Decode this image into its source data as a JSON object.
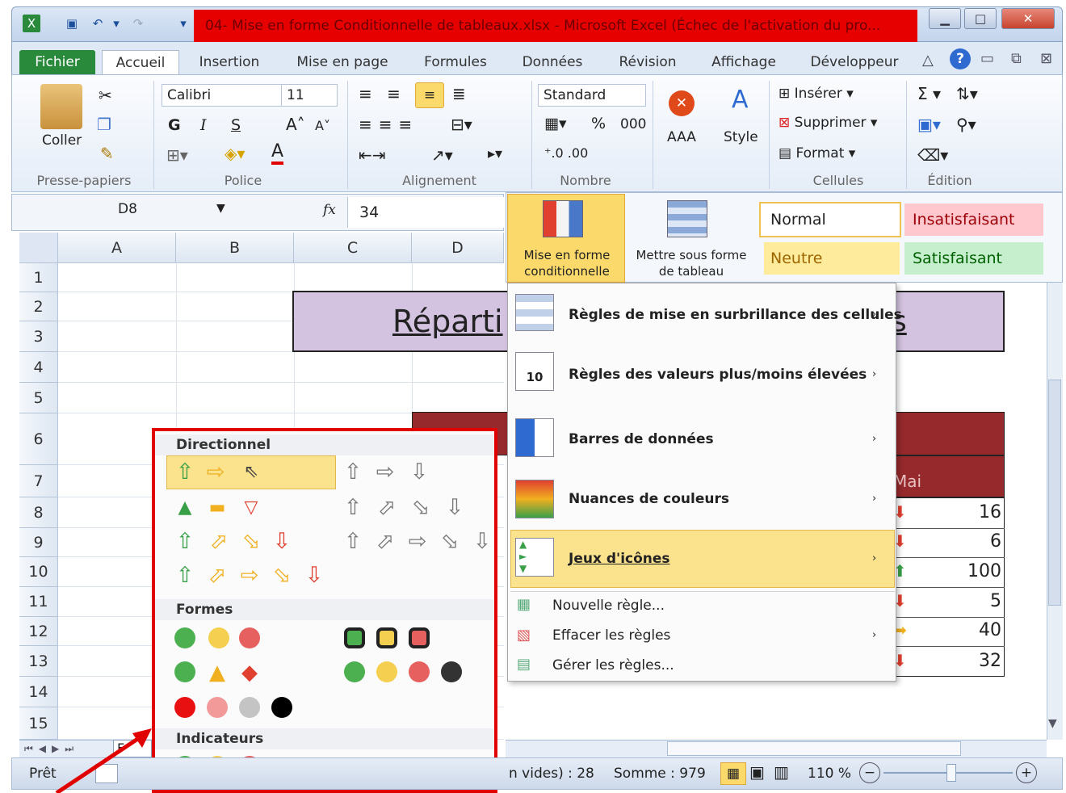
{
  "window": {
    "title": "04- Mise en forme Conditionnelle de tableaux.xlsx - Microsoft Excel (Échec de l'activation du pro..."
  },
  "tabs": [
    "Fichier",
    "Accueil",
    "Insertion",
    "Mise en page",
    "Formules",
    "Données",
    "Révision",
    "Affichage",
    "Développeur"
  ],
  "ribbon": {
    "paste": "Coller",
    "clipboard_group": "Presse-papiers",
    "font_name": "Calibri",
    "font_size": "11",
    "bold": "G",
    "italic": "I",
    "underline": "S",
    "font_group": "Police",
    "align_group": "Alignement",
    "number_format": "Standard",
    "number_group": "Nombre",
    "aaa": "AAA",
    "style": "Style",
    "insert": "Insérer",
    "delete": "Supprimer",
    "format": "Format",
    "cells_group": "Cellules",
    "edit_group": "Édition"
  },
  "formula": {
    "name_box": "D8",
    "fx": "fx",
    "value": "34"
  },
  "styles_gallery": {
    "conditional": "Mise en forme conditionnelle",
    "as_table": "Mettre sous forme de tableau",
    "normal": "Normal",
    "bad": "Insatisfaisant",
    "neutral": "Neutre",
    "good": "Satisfaisant"
  },
  "columns": [
    "A",
    "B",
    "C",
    "D"
  ],
  "rows": [
    "1",
    "2",
    "3",
    "4",
    "5",
    "6",
    "7",
    "8",
    "9",
    "10",
    "11",
    "12",
    "13",
    "14",
    "15"
  ],
  "sheet": {
    "title_fragment": "Réparti",
    "title_end": "s",
    "month_header": "Mai",
    "values": [
      "16",
      "6",
      "100",
      "5",
      "40",
      "32"
    ]
  },
  "cf_menu": {
    "highlight": "Règles de mise en surbrillance des cellules",
    "topbottom": "Règles des valeurs plus/moins élevées",
    "databars": "Barres de données",
    "colorscales": "Nuances de couleurs",
    "iconsets": "Jeux d'icônes",
    "new_rule": "Nouvelle règle...",
    "clear_rules": "Effacer les règles",
    "manage_rules": "Gérer les règles..."
  },
  "icon_sets": {
    "directional": "Directionnel",
    "shapes": "Formes",
    "indicators": "Indicateurs"
  },
  "status": {
    "ready": "Prêt",
    "count": "n vides) : 28",
    "sum": "Somme : 979",
    "zoom": "110 %",
    "sheet_tab": "F"
  },
  "colors": {
    "file_tab": "#2a8a3b",
    "title_bar_highlight": "#e60000",
    "header_purple": "#d4c3e0",
    "dark_red": "#96292c",
    "menu_hover": "#fbe28d",
    "annotation": "#e00000"
  }
}
